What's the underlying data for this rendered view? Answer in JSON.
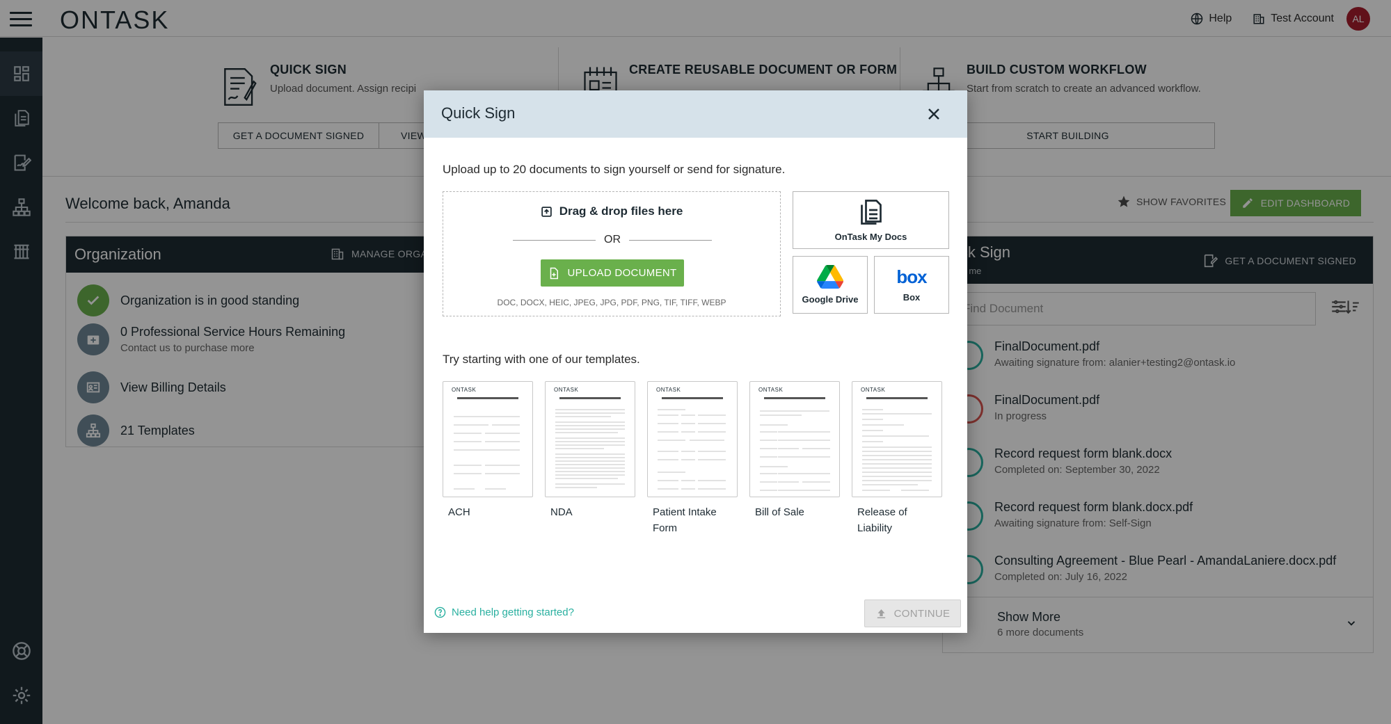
{
  "topbar": {
    "logo": "ONTASK",
    "help_label": "Help",
    "account_label": "Test Account",
    "avatar_initials": "AL"
  },
  "sidebar": {
    "items": [
      {
        "icon": "dashboard-icon"
      },
      {
        "icon": "documents-icon"
      },
      {
        "icon": "signature-icon"
      },
      {
        "icon": "workflow-icon"
      },
      {
        "icon": "organization-icon"
      },
      {
        "icon": "support-icon"
      },
      {
        "icon": "settings-icon"
      }
    ]
  },
  "quick_panels": [
    {
      "title": "QUICK SIGN",
      "desc": "Upload document. Assign recipi",
      "buttons": [
        "GET A DOCUMENT SIGNED",
        "VIEW"
      ]
    },
    {
      "title": "CREATE REUSABLE DOCUMENT OR FORM",
      "desc": "",
      "buttons": []
    },
    {
      "title": "BUILD CUSTOM WORKFLOW",
      "desc": "Start from scratch to create an advanced workflow.",
      "buttons": [
        "START BUILDING"
      ]
    }
  ],
  "dashboard": {
    "welcome": "Welcome back, Amanda",
    "show_favorites": "SHOW FAVORITES",
    "edit_dashboard": "EDIT DASHBOARD"
  },
  "organization": {
    "title": "Organization",
    "manage": "MANAGE ORGA",
    "rows": [
      {
        "text": "Organization is in good standing",
        "sub": ""
      },
      {
        "text": "0 Professional Service Hours Remaining",
        "sub": "Contact us to purchase more"
      },
      {
        "text": "View Billing Details",
        "sub": ""
      },
      {
        "text": "21 Templates",
        "sub": ""
      }
    ]
  },
  "documents_panel": {
    "title": "ick Sign",
    "subtitle": "by me",
    "get_signed": "GET A DOCUMENT SIGNED",
    "search_placeholder": "Find Document",
    "items": [
      {
        "title": "FinalDocument.pdf",
        "sub": "Awaiting signature from: alanier+testing2@ontask.io",
        "status_color": "#2ab0a0"
      },
      {
        "title": "FinalDocument.pdf",
        "sub": "In progress",
        "status_color": "#d9534f"
      },
      {
        "title": "Record request form blank.docx",
        "sub": "Completed on: September 30, 2022",
        "status_color": "#2ab0a0"
      },
      {
        "title": "Record request form blank.docx.pdf",
        "sub": "Awaiting signature from: Self-Sign",
        "status_color": "#2ab0a0"
      },
      {
        "title": "Consulting Agreement - Blue Pearl - AmandaLaniere.docx.pdf",
        "sub": "Completed on: July 16, 2022",
        "status_color": "#2ab0a0"
      }
    ],
    "show_more": "Show More",
    "show_more_sub": "6 more documents"
  },
  "modal": {
    "title": "Quick Sign",
    "upload_text": "Upload up to 20 documents to sign yourself or send for signature.",
    "dropzone_title": "Drag & drop files here",
    "or_label": "OR",
    "upload_button": "UPLOAD DOCUMENT",
    "file_types": "DOC, DOCX, HEIC, JPEG, JPG, PDF, PNG, TIF, TIFF, WEBP",
    "sources": {
      "ontask": "OnTask My Docs",
      "google": "Google Drive",
      "box": "Box",
      "box_logo": "box"
    },
    "templates_text": "Try starting with one of our templates.",
    "templates": [
      {
        "label": "ACH"
      },
      {
        "label": "NDA"
      },
      {
        "label": "Patient Intake Form"
      },
      {
        "label": "Bill of Sale"
      },
      {
        "label": "Release of Liability"
      }
    ],
    "help_link": "Need help getting started?",
    "continue_button": "CONTINUE"
  },
  "colors": {
    "brand_dark": "#1e2b33",
    "accent_green": "#6ab04c",
    "teal": "#2ab0a0",
    "modal_header": "#d6e2ea"
  }
}
